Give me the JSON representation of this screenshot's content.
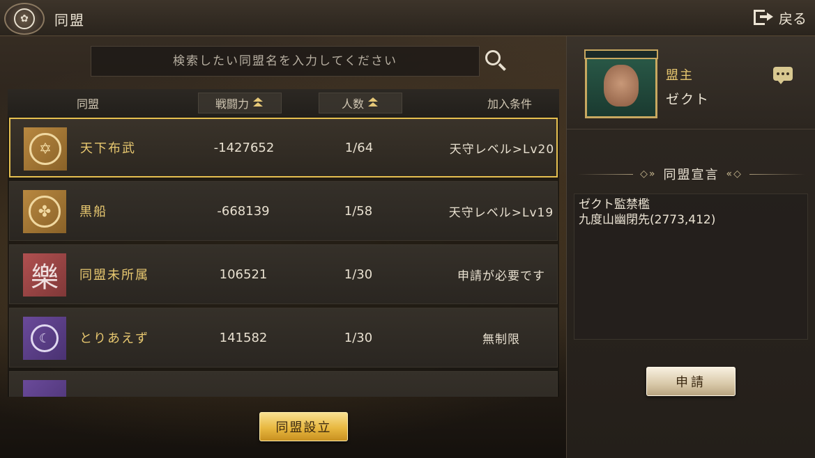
{
  "header": {
    "title": "同盟",
    "back_label": "戻る"
  },
  "search": {
    "placeholder": "検索したい同盟名を入力してください"
  },
  "table": {
    "columns": {
      "name": "同盟",
      "power": "戦闘力",
      "members": "人数",
      "condition": "加入条件"
    },
    "rows": [
      {
        "name": "天下布武",
        "power": "-1427652",
        "members": "1/64",
        "condition": "天守レベル>Lv20",
        "emblem": "star-in-circle-icon",
        "emblem_color": "#b88840",
        "selected": true
      },
      {
        "name": "黒船",
        "power": "-668139",
        "members": "1/58",
        "condition": "天守レベル>Lv19",
        "emblem": "flower-crest-icon",
        "emblem_color": "#b88840",
        "selected": false
      },
      {
        "name": "同盟未所属",
        "power": "106521",
        "members": "1/30",
        "condition": "申請が必要です",
        "emblem": "kanji-raku-icon",
        "emblem_glyph": "樂",
        "emblem_color": "#b05050",
        "selected": false
      },
      {
        "name": "とりあえず",
        "power": "141582",
        "members": "1/30",
        "condition": "無制限",
        "emblem": "crescent-crest-icon",
        "emblem_color": "#6a4a9a",
        "selected": false
      }
    ]
  },
  "create_button": "同盟設立",
  "leader": {
    "label": "盟主",
    "name": "ゼクト"
  },
  "declaration": {
    "title": "同盟宣言",
    "text_line1": "ゼクト監禁檻",
    "text_line2": "九度山幽閉先(2773,412)"
  },
  "apply_button": "申請",
  "colors": {
    "accent_gold": "#e6c050",
    "name_gold": "#e8c870"
  }
}
